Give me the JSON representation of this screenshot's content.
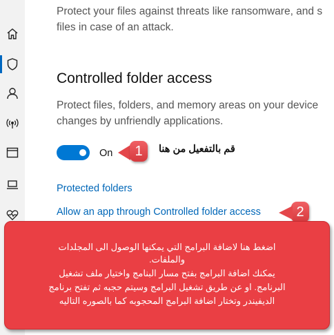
{
  "sidebar": {
    "icons": [
      "home-icon",
      "shield-icon",
      "person-icon",
      "wifi-antenna-icon",
      "browser-window-icon",
      "laptop-icon",
      "health-heart-icon"
    ],
    "active_index": 1
  },
  "ransomware": {
    "desc_line1": "Protect your files against threats like ransomware, and s",
    "desc_line2": "files in case of an attack."
  },
  "cfa": {
    "heading": "Controlled folder access",
    "desc_line1": "Protect files, folders, and memory areas on your device",
    "desc_line2": "changes by unfriendly applications.",
    "toggle_label": "On",
    "toggle_on": true,
    "link_protected": "Protected folders",
    "link_allow": "Allow an app through Controlled folder access"
  },
  "annotations": {
    "badge1": "1",
    "note1": "قم بالتفعيل من هنا",
    "badge2": "2",
    "box_lines": [
      "اضغط هنا لاضافة البرامج التي يمكنها الوصول الى المجلدات",
      "والملفات.",
      "يمكنك اضافة البرامج بفتح مسار البنامج واختيار ملف تشغيل",
      "البرنامج. او عن طريق تشغيل البرامج وسيتم حجبه ثم تفتح برنامج",
      "الديفيندر وتختار اضافة البرامج المحجوبه كما بالصوره التاليه"
    ]
  },
  "colors": {
    "accent": "#0078d4",
    "link": "#0067b8",
    "callout": "#ea3f44"
  }
}
